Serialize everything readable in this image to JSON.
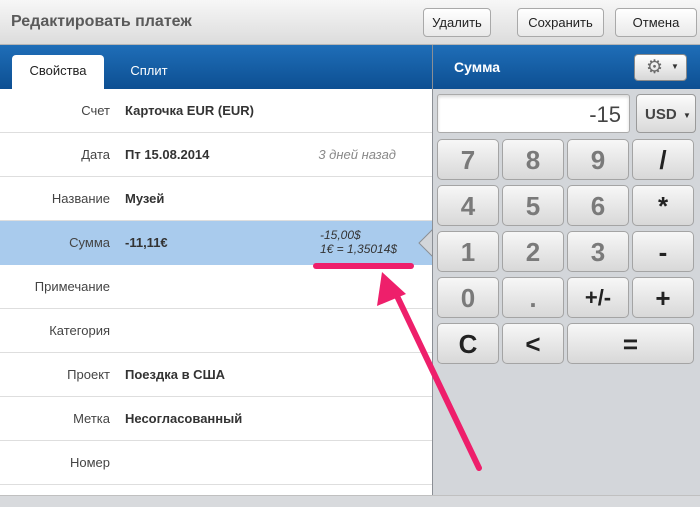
{
  "window": {
    "title": "Редактировать платеж",
    "buttons": {
      "delete": "Удалить",
      "save": "Сохранить",
      "cancel": "Отмена"
    }
  },
  "tabs": [
    {
      "label": "Свойства",
      "active": true
    },
    {
      "label": "Сплит",
      "active": false
    }
  ],
  "fields": {
    "account": {
      "label": "Счет",
      "value": "Карточка EUR (EUR)"
    },
    "date": {
      "label": "Дата",
      "value": "Пт 15.08.2014",
      "note": "3 дней назад"
    },
    "name": {
      "label": "Название",
      "value": "Музей"
    },
    "amount": {
      "label": "Сумма",
      "value": "-11,11€",
      "converted": "-15,00$",
      "rate": "1€ = 1,35014$"
    },
    "note": {
      "label": "Примечание",
      "value": ""
    },
    "category": {
      "label": "Категория",
      "value": ""
    },
    "project": {
      "label": "Проект",
      "value": "Поездка в США"
    },
    "tag": {
      "label": "Метка",
      "value": "Несогласованный"
    },
    "number": {
      "label": "Номер",
      "value": ""
    }
  },
  "calculator": {
    "title": "Сумма",
    "display": "-15",
    "currency": "USD",
    "keys": [
      "7",
      "8",
      "9",
      "/",
      "4",
      "5",
      "6",
      "*",
      "1",
      "2",
      "3",
      "-",
      "0",
      ".",
      "+/-",
      "+",
      "C",
      "<",
      "="
    ]
  },
  "icons": {
    "settings": "gear-icon",
    "dropdown": "caret-down-icon"
  },
  "colors": {
    "header_blue": "#1264ad",
    "selected_row": "#a9cbed",
    "annotation": "#ee1f6b"
  }
}
